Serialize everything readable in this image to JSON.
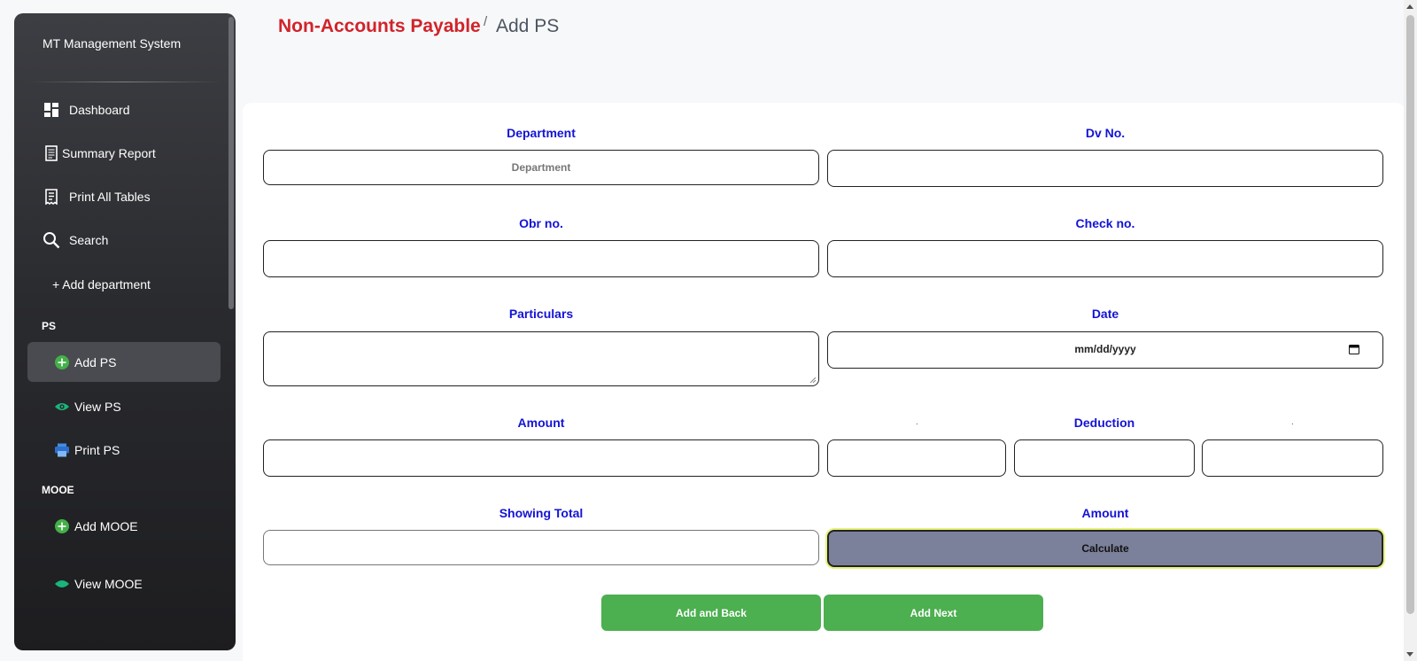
{
  "sidebar": {
    "brand": "MT Management System",
    "items": [
      {
        "label": "Dashboard"
      },
      {
        "label": "Summary Report"
      },
      {
        "label": "Print All Tables"
      },
      {
        "label": "Search"
      },
      {
        "label": "+ Add department"
      }
    ],
    "sections": [
      {
        "title": "PS",
        "items": [
          {
            "label": "Add PS"
          },
          {
            "label": "View PS"
          },
          {
            "label": "Print PS"
          }
        ]
      },
      {
        "title": "MOOE",
        "items": [
          {
            "label": "Add MOOE"
          },
          {
            "label": "View MOOE"
          }
        ]
      }
    ]
  },
  "header": {
    "title": "Non-Accounts Payable",
    "separator": "/",
    "subtitle": "Add PS"
  },
  "form": {
    "department_label": "Department",
    "department_placeholder": "Department",
    "dv_label": "Dv No.",
    "obr_label": "Obr no.",
    "check_label": "Check no.",
    "particulars_label": "Particulars",
    "date_label": "Date",
    "date_placeholder": "mm/dd/yyyy",
    "amount_label": "Amount",
    "deduction_label": "Deduction",
    "deduction_dot": ".",
    "showing_total_label": "Showing Total",
    "amount2_label": "Amount",
    "calculate_label": "Calculate",
    "add_back_label": "Add and Back",
    "add_next_label": "Add Next"
  },
  "colors": {
    "accent_red": "#d1232a",
    "label_blue": "#1313d6",
    "button_green": "#4caf50",
    "calculate_bg": "#7b809b"
  }
}
